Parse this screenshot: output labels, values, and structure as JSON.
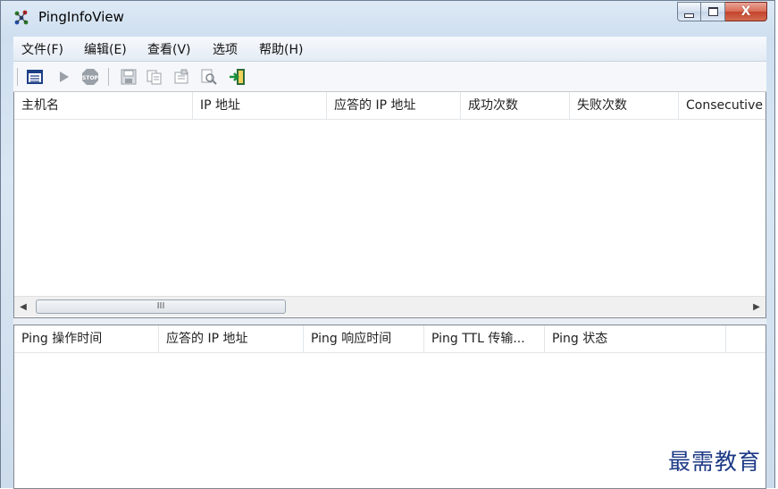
{
  "window": {
    "title": "PingInfoView",
    "app_icon": "network-nodes-icon",
    "caption_buttons": [
      "minimize-icon",
      "maximize-icon",
      "close-icon"
    ],
    "close_glyph": "X"
  },
  "menu": {
    "items": [
      {
        "label": "文件(F)"
      },
      {
        "label": "编辑(E)"
      },
      {
        "label": "查看(V)"
      },
      {
        "label": "选项"
      },
      {
        "label": "帮助(H)"
      }
    ]
  },
  "toolbar": {
    "buttons": [
      "html-report-icon",
      "play-icon",
      "stop-icon",
      "save-icon",
      "copy-icon",
      "properties-icon",
      "find-icon",
      "exit-icon"
    ]
  },
  "top_list": {
    "columns": [
      {
        "label": "主机名"
      },
      {
        "label": "IP 地址"
      },
      {
        "label": "应答的 IP 地址"
      },
      {
        "label": "成功次数"
      },
      {
        "label": "失败次数"
      },
      {
        "label": "Consecutive"
      }
    ],
    "rows": [],
    "scrollbar_thumb_glyph": "III"
  },
  "bottom_list": {
    "columns": [
      {
        "label": "Ping 操作时间"
      },
      {
        "label": "应答的 IP 地址"
      },
      {
        "label": "Ping 响应时间"
      },
      {
        "label": "Ping TTL 传输..."
      },
      {
        "label": "Ping 状态"
      },
      {
        "label": ""
      }
    ],
    "rows": []
  },
  "watermark": "最需教育"
}
